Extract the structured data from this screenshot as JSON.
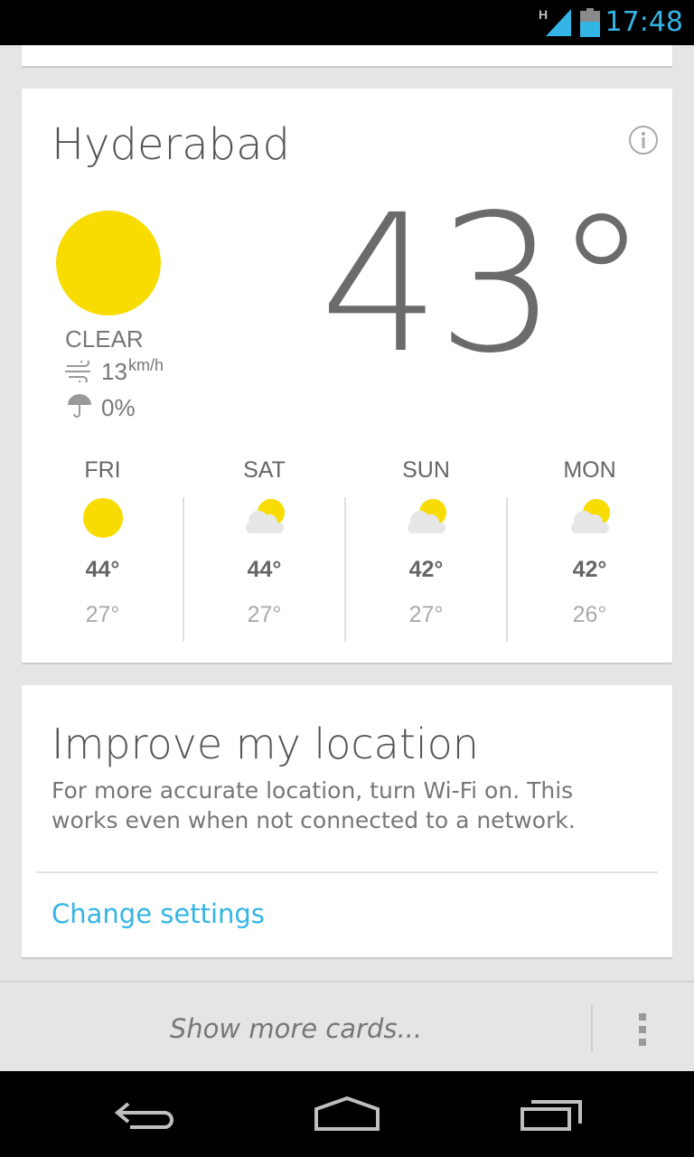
{
  "status_bar": {
    "network_type": "H",
    "time": "17:48",
    "accent_color": "#33b5e5"
  },
  "weather_card": {
    "city": "Hyderabad",
    "info_icon": "info-icon",
    "current": {
      "temperature": "43°",
      "condition": "CLEAR",
      "condition_icon": "sun-icon",
      "wind_speed": "13",
      "wind_unit": "km/h",
      "precipitation": "0%"
    },
    "forecast": [
      {
        "day": "FRI",
        "icon": "sun-icon",
        "high": "44°",
        "low": "27°"
      },
      {
        "day": "SAT",
        "icon": "partly-cloudy-icon",
        "high": "44°",
        "low": "27°"
      },
      {
        "day": "SUN",
        "icon": "partly-cloudy-icon",
        "high": "42°",
        "low": "27°"
      },
      {
        "day": "MON",
        "icon": "partly-cloudy-icon",
        "high": "42°",
        "low": "26°"
      }
    ],
    "sun_color": "#f8dc00"
  },
  "location_card": {
    "title": "Improve my location",
    "body": "For more accurate location, turn Wi-Fi on. This works even when not connected to a network.",
    "action": "Change settings"
  },
  "bottom_bar": {
    "more_cards": "Show more cards..."
  },
  "nav_bar": {
    "buttons": [
      "back-icon",
      "home-icon",
      "recent-apps-icon"
    ]
  }
}
